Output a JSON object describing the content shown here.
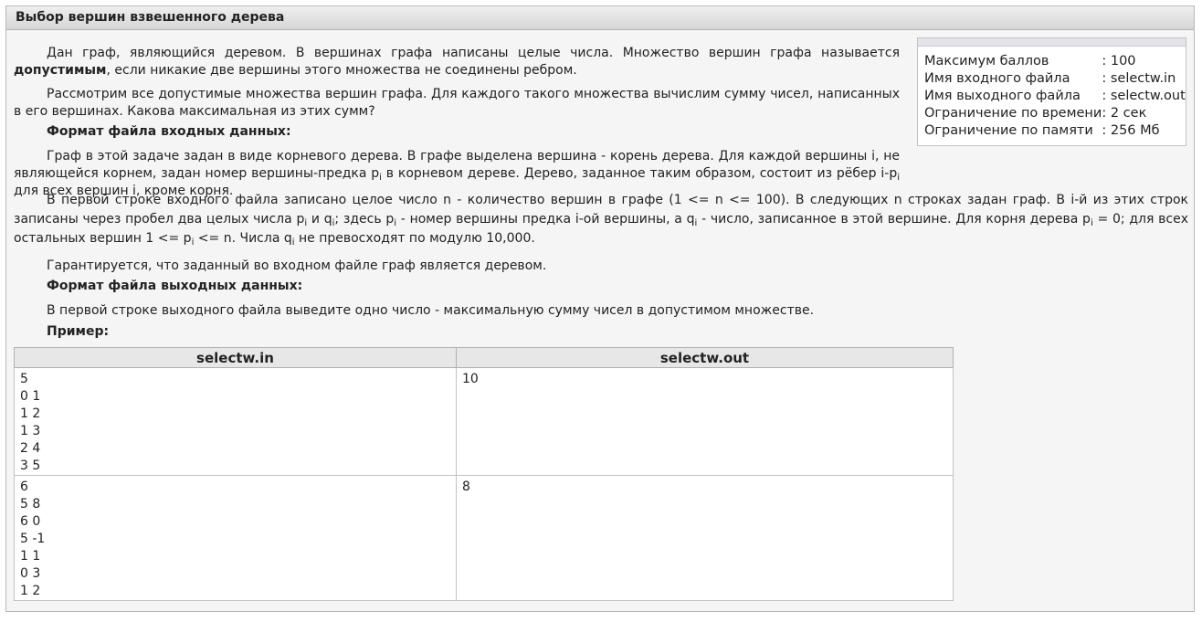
{
  "window": {
    "title": "Выбор вершин взвешенного дерева"
  },
  "limits": {
    "rows": [
      {
        "key": "Максимум баллов",
        "value": ": 100"
      },
      {
        "key": "Имя входного файла",
        "value": ": selectw.in"
      },
      {
        "key": "Имя выходного файла",
        "value": ": selectw.out"
      },
      {
        "key": "Ограничение по времени",
        "value": ": 2 сек"
      },
      {
        "key": "Ограничение по памяти",
        "value": ": 256 Мб"
      }
    ]
  },
  "statement": {
    "p1_a": "Дан граф, являющийся деревом. В вершинах графа написаны целые числа. Множество вершин графа называется ",
    "p1_bold": "допустимым",
    "p1_b": ", если никакие две вершины этого множества не соединены ребром.",
    "p2": "Рассмотрим все допустимые множества вершин графа. Для каждого такого множества вычислим сумму чисел, написанных в его вершинах. Какова максимальная из этих сумм?",
    "input_header": "Формат файла входных данных:",
    "p3_a": "Граф в этой задаче задан в виде корневого дерева. В графе выделена вершина - корень дерева. Для каждой вершины i, не являющейся корнем, задан номер вершины-предка p",
    "p3_sub1": "i",
    "p3_b": " в корневом дереве. Дерево, заданное таким образом, состоит из рёбер i-p",
    "p3_sub2": "i",
    "p3_c": " для всех вершин i, кроме корня.",
    "p4_a": "В первой строке входного файла записано целое число n - количество вершин в графе (1 <= n <= 100). В следующих n строках задан граф. В i-й из этих строк записаны через пробел два целых числа p",
    "p4_s1": "i",
    "p4_b": " и q",
    "p4_s2": "i",
    "p4_c": "; здесь p",
    "p4_s3": "i",
    "p4_d": " - номер вершины предка i-ой вершины, а q",
    "p4_s4": "i",
    "p4_e": " - число, записанное в этой вершине. Для корня дерева p",
    "p4_s5": "i",
    "p4_f": " = 0; для всех остальных вершин 1 <= p",
    "p4_s6": "i",
    "p4_g": " <= n. Числа q",
    "p4_s7": "i",
    "p4_h": " не превосходят по модулю 10,000.",
    "p5": "Гарантируется, что заданный во входном файле граф является деревом.",
    "output_header": "Формат файла выходных данных:",
    "p6": "В первой строке выходного файла выведите одно число - максимальную сумму чисел в допустимом множестве.",
    "example_header": "Пример:"
  },
  "examples": {
    "col_in": "selectw.in",
    "col_out": "selectw.out",
    "rows": [
      {
        "in": "5\n0 1\n1 2\n1 3\n2 4\n3 5",
        "out": "10"
      },
      {
        "in": "6\n5 8\n6 0\n5 -1\n1 1\n0 3\n1 2",
        "out": "8"
      }
    ]
  }
}
